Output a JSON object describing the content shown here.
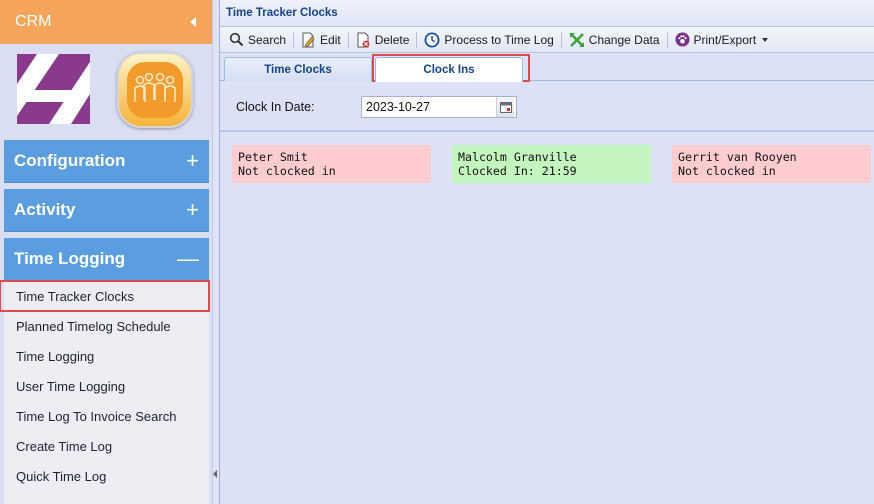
{
  "sidebar": {
    "app_name": "CRM",
    "sections": [
      {
        "label": "Configuration",
        "state_symbol": "+"
      },
      {
        "label": "Activity",
        "state_symbol": "+"
      },
      {
        "label": "Time Logging",
        "state_symbol": "—"
      }
    ],
    "items": [
      {
        "label": "Time Tracker Clocks",
        "highlighted": true
      },
      {
        "label": "Planned Timelog Schedule"
      },
      {
        "label": "Time Logging"
      },
      {
        "label": "User Time Logging"
      },
      {
        "label": "Time Log To Invoice Search"
      },
      {
        "label": "Create Time Log"
      },
      {
        "label": "Quick Time Log"
      }
    ]
  },
  "panel": {
    "title": "Time Tracker Clocks",
    "toolbar": {
      "search": "Search",
      "edit": "Edit",
      "delete": "Delete",
      "process": "Process to Time Log",
      "change": "Change Data",
      "print": "Print/Export"
    },
    "tabs": [
      {
        "label": "Time Clocks",
        "active": false
      },
      {
        "label": "Clock Ins",
        "active": true
      }
    ],
    "form": {
      "clock_in_label": "Clock In Date:",
      "clock_in_value": "2023-10-27"
    },
    "employees": [
      {
        "name": "Peter Smit",
        "status": "Not clocked in"
      },
      {
        "name": "Malcolm Granville",
        "status": "Clocked In: 21:59"
      },
      {
        "name": "Gerrit van Rooyen",
        "status": "Not clocked in"
      }
    ]
  },
  "colors": {
    "crm_header": "#f4a55a",
    "accordion": "#5b9ee0",
    "highlight_frame": "#e04a4a",
    "not_clocked_in": "#ffcdd0",
    "clocked_in": "#c4f5bf"
  }
}
